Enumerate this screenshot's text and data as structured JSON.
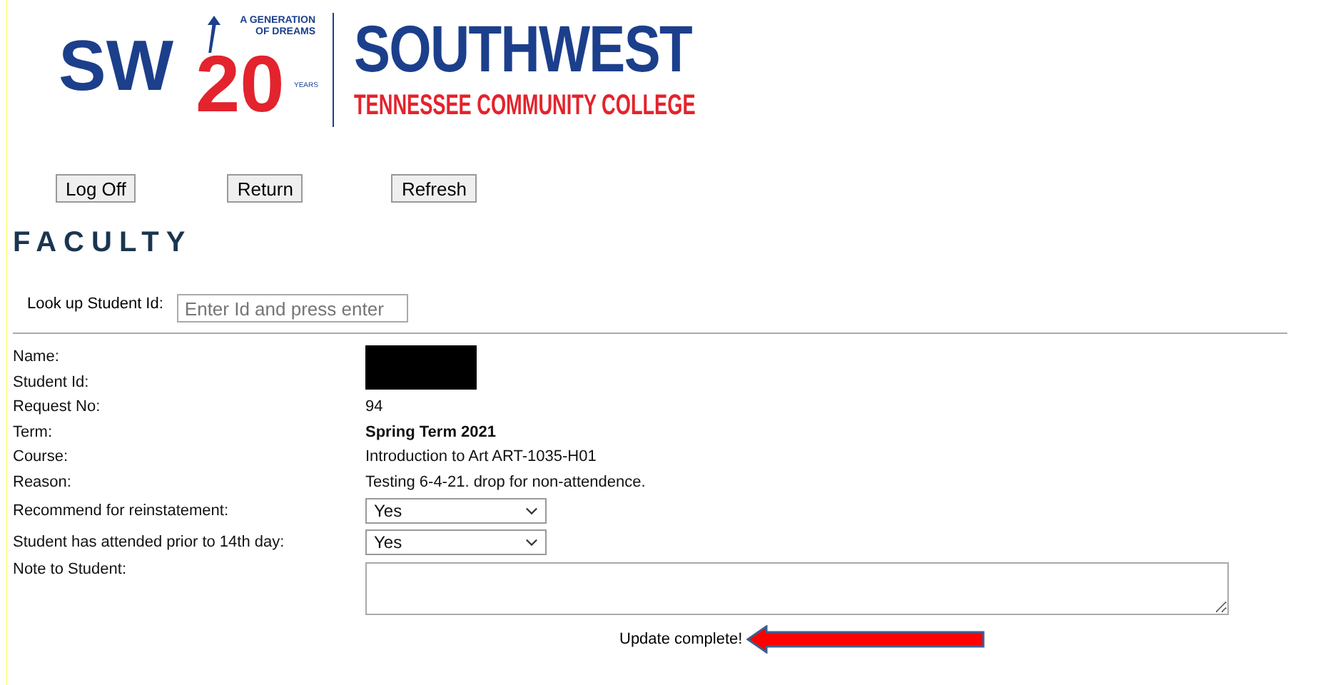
{
  "logo": {
    "mark_letters": "SW",
    "mark_number": "20",
    "tagline": "A GENERATION OF DREAMS",
    "years": "YEARS",
    "name": "SOUTHWEST",
    "subtitle": "TENNESSEE COMMUNITY COLLEGE"
  },
  "buttons": [
    "Log Off",
    "Return",
    "Refresh"
  ],
  "heading": "FACULTY",
  "lookup": {
    "label": "Look up Student Id:",
    "placeholder": "Enter Id and press enter"
  },
  "details": {
    "redacted": true,
    "rows": [
      {
        "kind": "blank",
        "label": "Name:"
      },
      {
        "kind": "blank",
        "label": "Student Id:"
      },
      {
        "kind": "text",
        "label": "Request No:",
        "value": "94"
      },
      {
        "kind": "bold",
        "label": "Term:",
        "value": "Spring Term 2021"
      },
      {
        "kind": "text",
        "label": "Course:",
        "value": "Introduction to Art ART-1035-H01"
      },
      {
        "kind": "text",
        "label": "Reason:",
        "value": "Testing 6-4-21. drop for non-attendence."
      },
      {
        "kind": "select",
        "label": "Recommend for reinstatement:",
        "value": "Yes"
      },
      {
        "kind": "select",
        "label": "Student has attended prior to 14th day:",
        "value": "Yes"
      },
      {
        "kind": "textarea",
        "label": "Note to Student:"
      }
    ]
  },
  "status": {
    "message": "Update complete!",
    "arrow": true
  }
}
